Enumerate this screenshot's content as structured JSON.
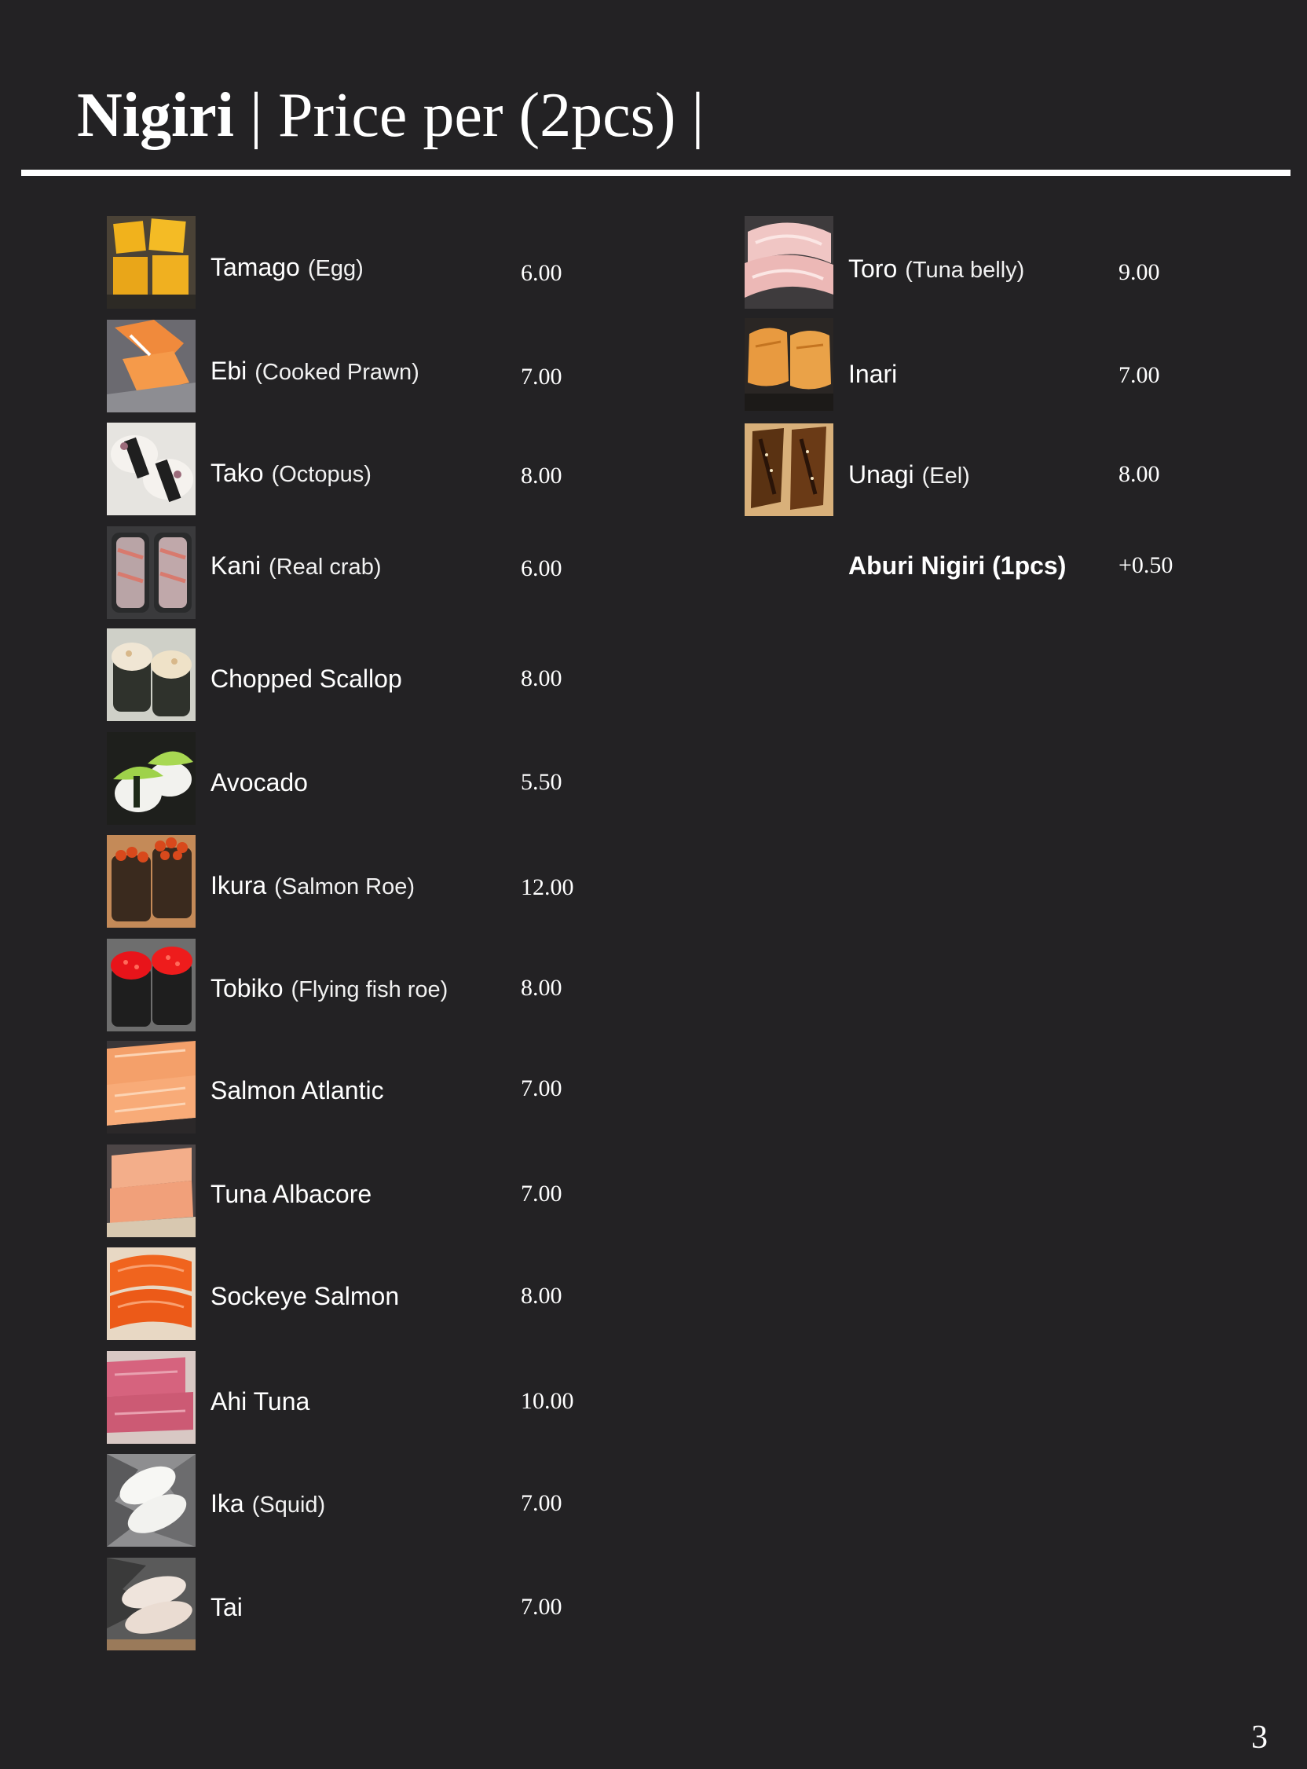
{
  "header": {
    "title_strong": "Nigiri",
    "title_rest": " | Price per (2pcs) |"
  },
  "left_items": [
    {
      "name": "Tamago",
      "note": "(Egg)",
      "price": "6.00"
    },
    {
      "name": "Ebi",
      "note": "(Cooked Prawn)",
      "price": "7.00"
    },
    {
      "name": "Tako",
      "note": "(Octopus)",
      "price": "8.00"
    },
    {
      "name": "Kani",
      "note": "(Real crab)",
      "price": "6.00"
    },
    {
      "name": "Chopped Scallop",
      "note": "",
      "price": "8.00"
    },
    {
      "name": "Avocado",
      "note": "",
      "price": "5.50"
    },
    {
      "name": "Ikura",
      "note": "(Salmon Roe)",
      "price": "12.00"
    },
    {
      "name": "Tobiko",
      "note": "(Flying fish roe)",
      "price": "8.00"
    },
    {
      "name": "Salmon Atlantic",
      "note": "",
      "price": "7.00"
    },
    {
      "name": "Tuna Albacore",
      "note": "",
      "price": "7.00"
    },
    {
      "name": "Sockeye Salmon",
      "note": "",
      "price": "8.00"
    },
    {
      "name": "Ahi Tuna",
      "note": "",
      "price": "10.00"
    },
    {
      "name": "Ika",
      "note": "(Squid)",
      "price": "7.00"
    },
    {
      "name": "Tai",
      "note": "",
      "price": "7.00"
    }
  ],
  "right_items": [
    {
      "name": "Toro",
      "note": "(Tuna belly)",
      "price": "9.00"
    },
    {
      "name": "Inari",
      "note": "",
      "price": "7.00"
    },
    {
      "name": "Unagi",
      "note": "(Eel)",
      "price": "8.00"
    }
  ],
  "aburi": {
    "name": "Aburi Nigiri (1pcs)",
    "price": "+0.50"
  },
  "page_number": "3",
  "colors": {
    "background": "#232224",
    "text": "#ffffff"
  }
}
